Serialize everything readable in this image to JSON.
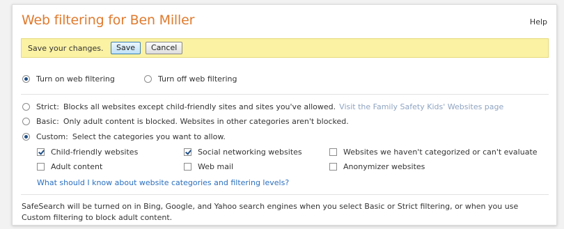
{
  "header": {
    "title": "Web filtering for Ben Miller",
    "help": "Help"
  },
  "savebar": {
    "message": "Save your changes.",
    "save_label": "Save",
    "cancel_label": "Cancel"
  },
  "filtering": {
    "on_label": "Turn on web filtering",
    "off_label": "Turn off web filtering",
    "selected": "on"
  },
  "levels": {
    "selected": "custom",
    "strict": {
      "label": "Strict:",
      "description": "Blocks all websites except child-friendly sites and sites you've allowed.",
      "link": "Visit the Family Safety Kids' Websites page"
    },
    "basic": {
      "label": "Basic:",
      "description": "Only adult content is blocked. Websites in other categories aren't blocked."
    },
    "custom": {
      "label": "Custom:",
      "description": "Select the categories you want to allow."
    }
  },
  "categories": [
    {
      "label": "Child-friendly websites",
      "checked": true
    },
    {
      "label": "Social networking websites",
      "checked": true
    },
    {
      "label": "Websites we haven't categorized or can't evaluate",
      "checked": false
    },
    {
      "label": "Adult content",
      "checked": false
    },
    {
      "label": "Web mail",
      "checked": false
    },
    {
      "label": "Anonymizer websites",
      "checked": false
    }
  ],
  "categories_link": "What should I know about website categories and filtering levels?",
  "footer": {
    "line1": "SafeSearch will be turned on in Bing, Google, and Yahoo search engines when you select Basic or Strict filtering, or when you use",
    "line2": "Custom filtering to block adult content."
  },
  "colors": {
    "title": "#e07a2e",
    "savebar": "#fbf2a4",
    "link": "#2a6fbf"
  }
}
